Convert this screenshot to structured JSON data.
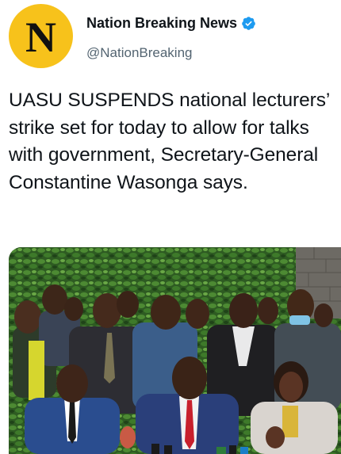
{
  "account": {
    "avatar_letter": "N",
    "display_name": "Nation Breaking News",
    "handle": "@NationBreaking",
    "verified": true,
    "avatar_color": "#f7c21b",
    "verified_color": "#1d9bf0"
  },
  "tweet": {
    "text": "UASU SUSPENDS national lecturers’ strike set for today to allow for talks with government, Secretary-General Constantine Wasonga says."
  },
  "media": {
    "kind": "photo",
    "subject": "group-of-men-and-woman-at-press-conference"
  }
}
